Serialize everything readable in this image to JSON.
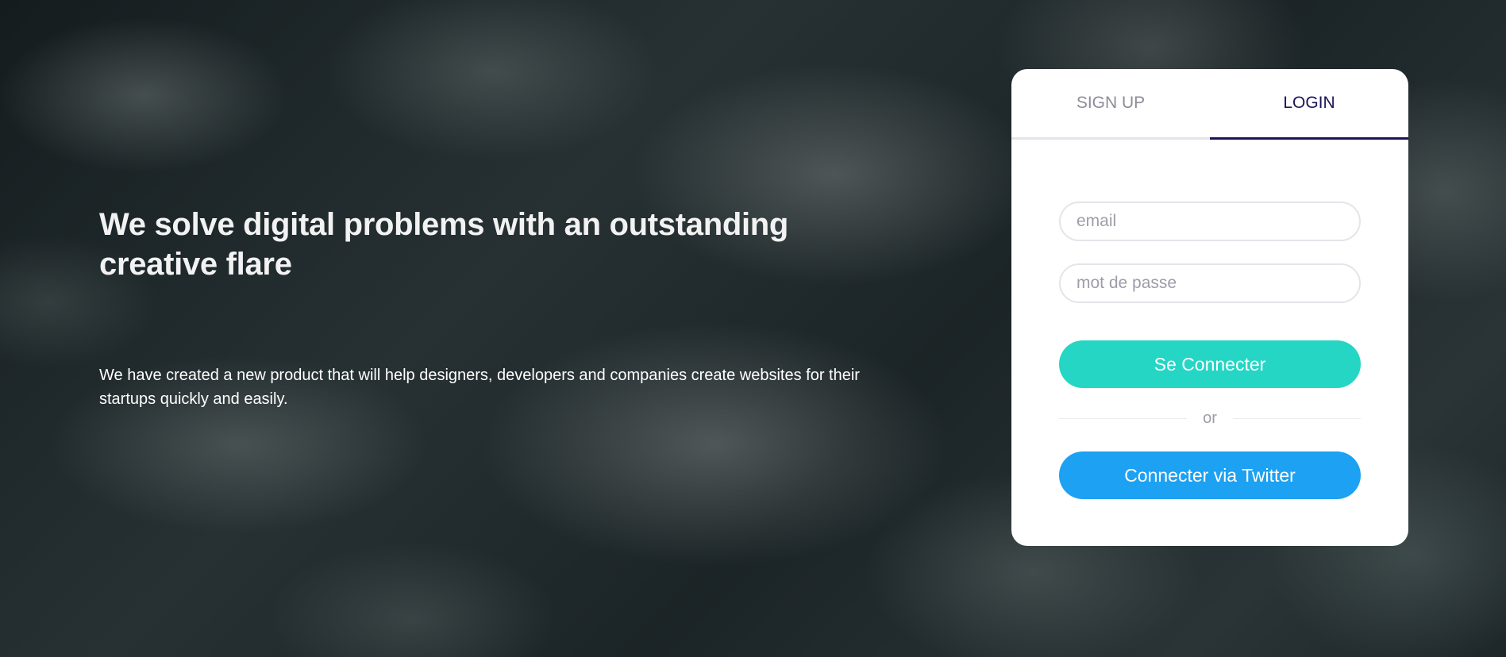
{
  "hero": {
    "title": "We solve digital problems with an outstanding creative flare",
    "description": "We have created a new product that will help designers, developers and companies create websites for their startups quickly and easily."
  },
  "auth": {
    "tabs": {
      "signup": "SIGN UP",
      "login": "LOGIN",
      "active": "login"
    },
    "email_placeholder": "email",
    "password_placeholder": "mot de passe",
    "login_button": "Se Connecter",
    "divider_text": "or",
    "twitter_button": "Connecter via Twitter"
  },
  "colors": {
    "accent_teal": "#25d6c4",
    "twitter_blue": "#1da1f2",
    "active_tab": "#1c1457",
    "inactive_tab": "#8e8c99"
  }
}
